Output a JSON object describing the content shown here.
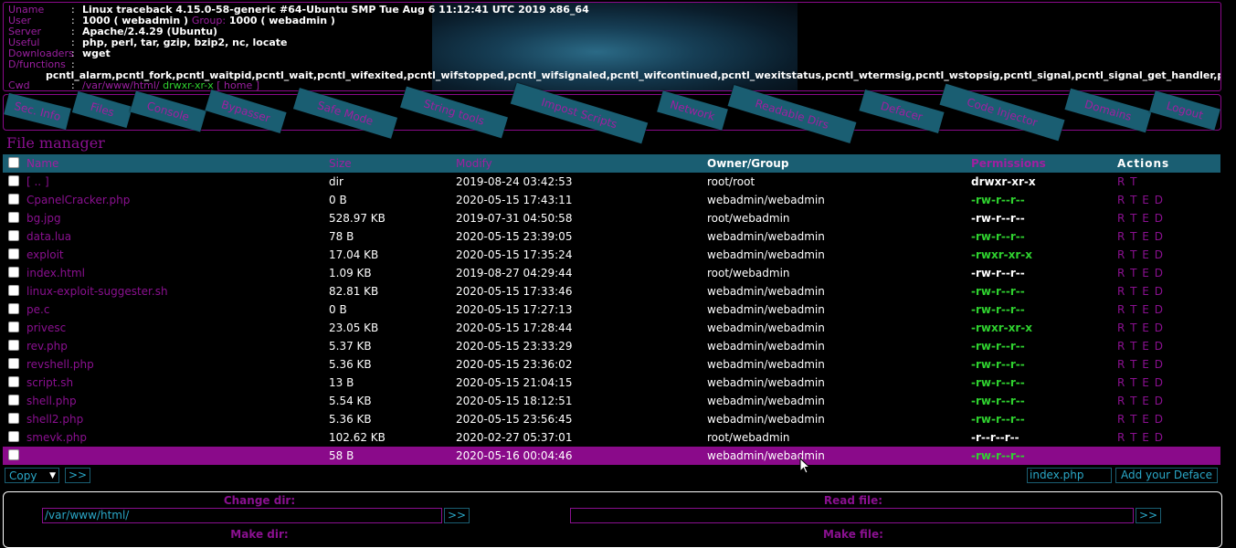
{
  "info": {
    "rows": [
      {
        "key": "Uname",
        "value": "Linux traceback 4.15.0-58-generic #64-Ubuntu SMP Tue Aug 6 11:12:41 UTC 2019 x86_64"
      },
      {
        "key": "User",
        "value": "1000 ( webadmin )",
        "group_key": "Group:",
        "group_value": "1000 ( webadmin )"
      },
      {
        "key": "Server",
        "value": "Apache/2.4.29 (Ubuntu)"
      },
      {
        "key": "Useful",
        "value": "php, perl, tar, gzip, bzip2, nc, locate"
      },
      {
        "key": "Downloaders",
        "value": "wget"
      },
      {
        "key": "D/functions",
        "value": ""
      }
    ],
    "separator": ":",
    "disabled_functions": "pcntl_alarm,pcntl_fork,pcntl_waitpid,pcntl_wait,pcntl_wifexited,pcntl_wifstopped,pcntl_wifsignaled,pcntl_wifcontinued,pcntl_wexitstatus,pcntl_wtermsig,pcntl_wstopsig,pcntl_signal,pcntl_signal_get_handler,pcntl_signal_dispatch,pcntl_",
    "cwd_key": "Cwd",
    "cwd_path": "/var/www/html/",
    "cwd_perm": "drwxr-xr-x",
    "cwd_home": "[ home ]"
  },
  "menu": [
    "Sec. Info",
    "Files",
    "Console",
    "Bypasser",
    "Safe Mode",
    "String tools",
    "Impost Scripts",
    "Network",
    "Readable Dirs",
    "Defacer",
    "Code Injector",
    "Domains",
    "Logout"
  ],
  "file_manager": {
    "title": "File manager",
    "columns": {
      "name": "Name",
      "size": "Size",
      "modify": "Modify",
      "owner": "Owner/Group",
      "permissions": "Permissions",
      "actions": "Actions"
    },
    "rows": [
      {
        "name": "[ .. ]",
        "size": "dir",
        "modify": "2019-08-24 03:42:53",
        "owner": "root/root",
        "perm": "drwxr-xr-x",
        "perm_color": "white",
        "actions": "R T"
      },
      {
        "name": "CpanelCracker.php",
        "size": "0 B",
        "modify": "2020-05-15 17:43:11",
        "owner": "webadmin/webadmin",
        "perm": "-rw-r--r--",
        "perm_color": "green",
        "actions": "R T E D"
      },
      {
        "name": "bg.jpg",
        "size": "528.97 KB",
        "modify": "2019-07-31 04:50:58",
        "owner": "root/webadmin",
        "perm": "-rw-r--r--",
        "perm_color": "white",
        "actions": "R T E D"
      },
      {
        "name": "data.lua",
        "size": "78 B",
        "modify": "2020-05-15 23:39:05",
        "owner": "webadmin/webadmin",
        "perm": "-rw-r--r--",
        "perm_color": "green",
        "actions": "R T E D"
      },
      {
        "name": "exploit",
        "size": "17.04 KB",
        "modify": "2020-05-15 17:35:24",
        "owner": "webadmin/webadmin",
        "perm": "-rwxr-xr-x",
        "perm_color": "green",
        "actions": "R T E D"
      },
      {
        "name": "index.html",
        "size": "1.09 KB",
        "modify": "2019-08-27 04:29:44",
        "owner": "root/webadmin",
        "perm": "-rw-r--r--",
        "perm_color": "white",
        "actions": "R T E D"
      },
      {
        "name": "linux-exploit-suggester.sh",
        "size": "82.81 KB",
        "modify": "2020-05-15 17:33:46",
        "owner": "webadmin/webadmin",
        "perm": "-rw-r--r--",
        "perm_color": "green",
        "actions": "R T E D"
      },
      {
        "name": "pe.c",
        "size": "0 B",
        "modify": "2020-05-15 17:27:13",
        "owner": "webadmin/webadmin",
        "perm": "-rw-r--r--",
        "perm_color": "green",
        "actions": "R T E D"
      },
      {
        "name": "privesc",
        "size": "23.05 KB",
        "modify": "2020-05-15 17:28:44",
        "owner": "webadmin/webadmin",
        "perm": "-rwxr-xr-x",
        "perm_color": "green",
        "actions": "R T E D"
      },
      {
        "name": "rev.php",
        "size": "5.37 KB",
        "modify": "2020-05-15 23:33:29",
        "owner": "webadmin/webadmin",
        "perm": "-rw-r--r--",
        "perm_color": "green",
        "actions": "R T E D"
      },
      {
        "name": "revshell.php",
        "size": "5.36 KB",
        "modify": "2020-05-15 23:36:02",
        "owner": "webadmin/webadmin",
        "perm": "-rw-r--r--",
        "perm_color": "green",
        "actions": "R T E D"
      },
      {
        "name": "script.sh",
        "size": "13 B",
        "modify": "2020-05-15 21:04:15",
        "owner": "webadmin/webadmin",
        "perm": "-rw-r--r--",
        "perm_color": "green",
        "actions": "R T E D"
      },
      {
        "name": "shell.php",
        "size": "5.54 KB",
        "modify": "2020-05-15 18:12:51",
        "owner": "webadmin/webadmin",
        "perm": "-rw-r--r--",
        "perm_color": "green",
        "actions": "R T E D"
      },
      {
        "name": "shell2.php",
        "size": "5.36 KB",
        "modify": "2020-05-15 23:56:45",
        "owner": "webadmin/webadmin",
        "perm": "-rw-r--r--",
        "perm_color": "green",
        "actions": "R T E D"
      },
      {
        "name": "smevk.php",
        "size": "102.62 KB",
        "modify": "2020-02-27 05:37:01",
        "owner": "root/webadmin",
        "perm": "-r--r--r--",
        "perm_color": "white",
        "actions": "R T E D"
      },
      {
        "name": "",
        "size": "58 B",
        "modify": "2020-05-16 00:04:46",
        "owner": "webadmin/webadmin",
        "perm": "-rw-r--r--",
        "perm_color": "green",
        "actions": "",
        "selected": true
      }
    ]
  },
  "bottom": {
    "copy_select": "Copy",
    "go_label": ">>",
    "deface_file": "index.php",
    "deface_button": "Add your Deface"
  },
  "tools": {
    "change_dir_label": "Change dir:",
    "change_dir_value": "/var/www/html/",
    "read_file_label": "Read file:",
    "read_file_value": "",
    "go_label": ">>",
    "make_dir_label": "Make dir:",
    "make_file_label": "Make file:"
  },
  "colors": {
    "accent": "#8a0a8a",
    "tab_bg": "#1a5e72",
    "perm_green": "#2fd22f",
    "input_text": "#2aa7c7"
  }
}
